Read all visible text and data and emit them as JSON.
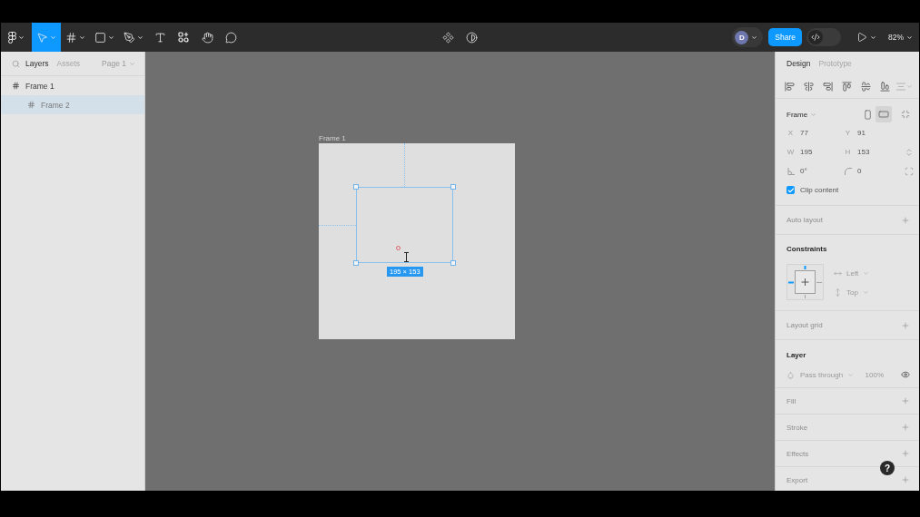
{
  "toolbar": {
    "tools": [
      {
        "kind": "main-menu",
        "dropdown": true,
        "selected": false
      },
      {
        "kind": "move",
        "dropdown": true,
        "selected": true
      },
      {
        "kind": "frame",
        "dropdown": true,
        "selected": false
      },
      {
        "kind": "shape",
        "dropdown": true,
        "selected": false
      },
      {
        "kind": "pen",
        "dropdown": true,
        "selected": false
      },
      {
        "kind": "text",
        "dropdown": false,
        "selected": false
      },
      {
        "kind": "resources",
        "dropdown": false,
        "selected": false
      },
      {
        "kind": "hand",
        "dropdown": false,
        "selected": false
      },
      {
        "kind": "comment",
        "dropdown": false,
        "selected": false
      }
    ],
    "center_tools": [
      {
        "kind": "component"
      },
      {
        "kind": "contrast"
      }
    ],
    "avatar": "D",
    "share": "Share",
    "dev_mode": {
      "on": false
    },
    "zoom": "82%"
  },
  "left_panel": {
    "tabs": [
      {
        "label": "Layers",
        "selected": true
      },
      {
        "label": "Assets",
        "selected": false
      }
    ],
    "page": "Page 1",
    "layers": [
      {
        "name": "Frame 1",
        "selected": false,
        "children": [
          {
            "name": "Frame 2",
            "selected": true
          }
        ]
      }
    ]
  },
  "canvas": {
    "frame_label": "Frame 1",
    "size_label": "195 × 153"
  },
  "right_panel": {
    "tabs": [
      {
        "label": "Design",
        "selected": true
      },
      {
        "label": "Prototype",
        "selected": false
      }
    ],
    "align_tools": [
      {
        "kind": "left",
        "disabled": false
      },
      {
        "kind": "center-h",
        "disabled": false
      },
      {
        "kind": "right",
        "disabled": false
      },
      {
        "kind": "top",
        "disabled": false
      },
      {
        "kind": "center-v",
        "disabled": false
      },
      {
        "kind": "bottom",
        "disabled": false
      },
      {
        "kind": "distribute",
        "disabled": true
      }
    ],
    "frame": {
      "title": "Frame",
      "orientations": [
        {
          "kind": "portrait",
          "selected": false
        },
        {
          "kind": "landscape",
          "selected": true
        }
      ],
      "fields": [
        {
          "kind": "letter",
          "label": "X",
          "value": "77"
        },
        {
          "kind": "letter",
          "label": "Y",
          "value": "91"
        },
        {
          "kind": "letter",
          "label": "W",
          "value": "195"
        },
        {
          "kind": "letter",
          "label": "H",
          "value": "153"
        },
        {
          "kind": "rotation",
          "value": "0°"
        },
        {
          "kind": "radius",
          "value": "0"
        }
      ],
      "clip_content": {
        "label": "Clip content",
        "checked": true
      }
    },
    "auto_layout": {
      "title": "Auto layout"
    },
    "constraints": {
      "title": "Constraints",
      "pins": {
        "top": true,
        "right": false,
        "bottom": false,
        "left": true
      },
      "horizontal": "Left",
      "vertical": "Top"
    },
    "layout_grid": {
      "title": "Layout grid"
    },
    "layer": {
      "title": "Layer",
      "blend": "Pass through",
      "opacity": "100%",
      "visible": true
    },
    "sections": [
      {
        "title": "Fill"
      },
      {
        "title": "Stroke"
      },
      {
        "title": "Effects"
      },
      {
        "title": "Export"
      }
    ]
  },
  "help_button": "?"
}
